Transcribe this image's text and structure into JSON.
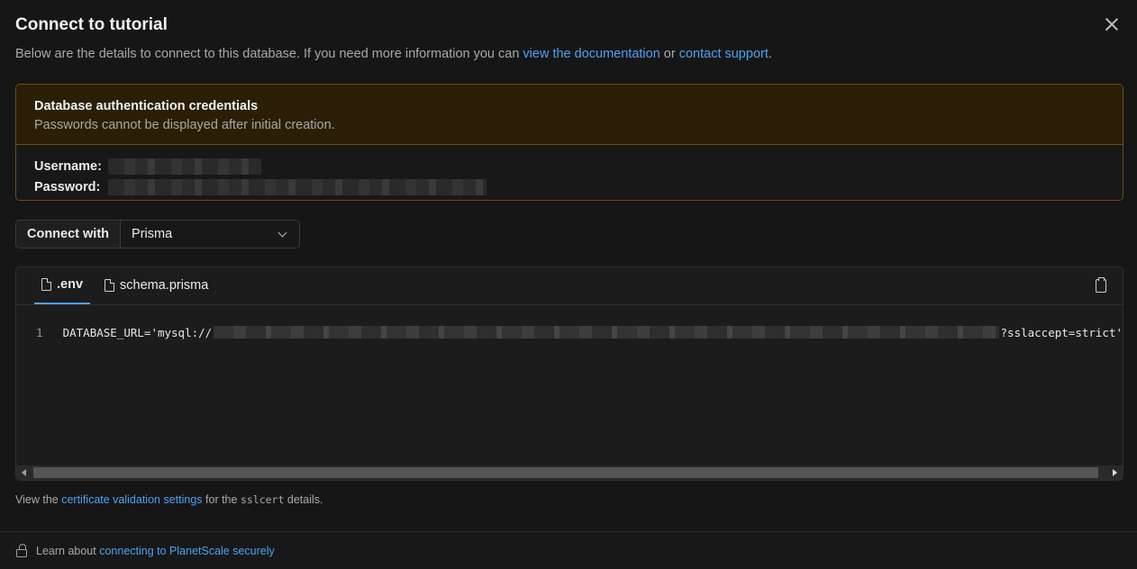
{
  "dialog": {
    "title": "Connect to tutorial",
    "subtitle_prefix": "Below are the details to connect to this database. If you need more information you can ",
    "doc_link": "view the documentation",
    "subtitle_or": " or ",
    "support_link": "contact support",
    "subtitle_suffix": "."
  },
  "credentials": {
    "title": "Database authentication credentials",
    "description": "Passwords cannot be displayed after initial creation.",
    "username_label": "Username:",
    "password_label": "Password:"
  },
  "connect": {
    "label": "Connect with",
    "selected": "Prisma"
  },
  "code": {
    "tabs": [
      {
        "label": ".env"
      },
      {
        "label": "schema.prisma"
      }
    ],
    "line_number": "1",
    "line_prefix": "DATABASE_URL='mysql://",
    "line_suffix": "?sslaccept=strict'"
  },
  "cert_note": {
    "prefix": "View the ",
    "link": "certificate validation settings",
    "middle": " for the ",
    "code": "sslcert",
    "suffix": " details."
  },
  "footer": {
    "prefix": "Learn about ",
    "link": "connecting to PlanetScale securely"
  },
  "colors": {
    "accent": "#4aa3f0",
    "warning_bg": "#2a1f06",
    "warning_border": "#6b5215"
  }
}
